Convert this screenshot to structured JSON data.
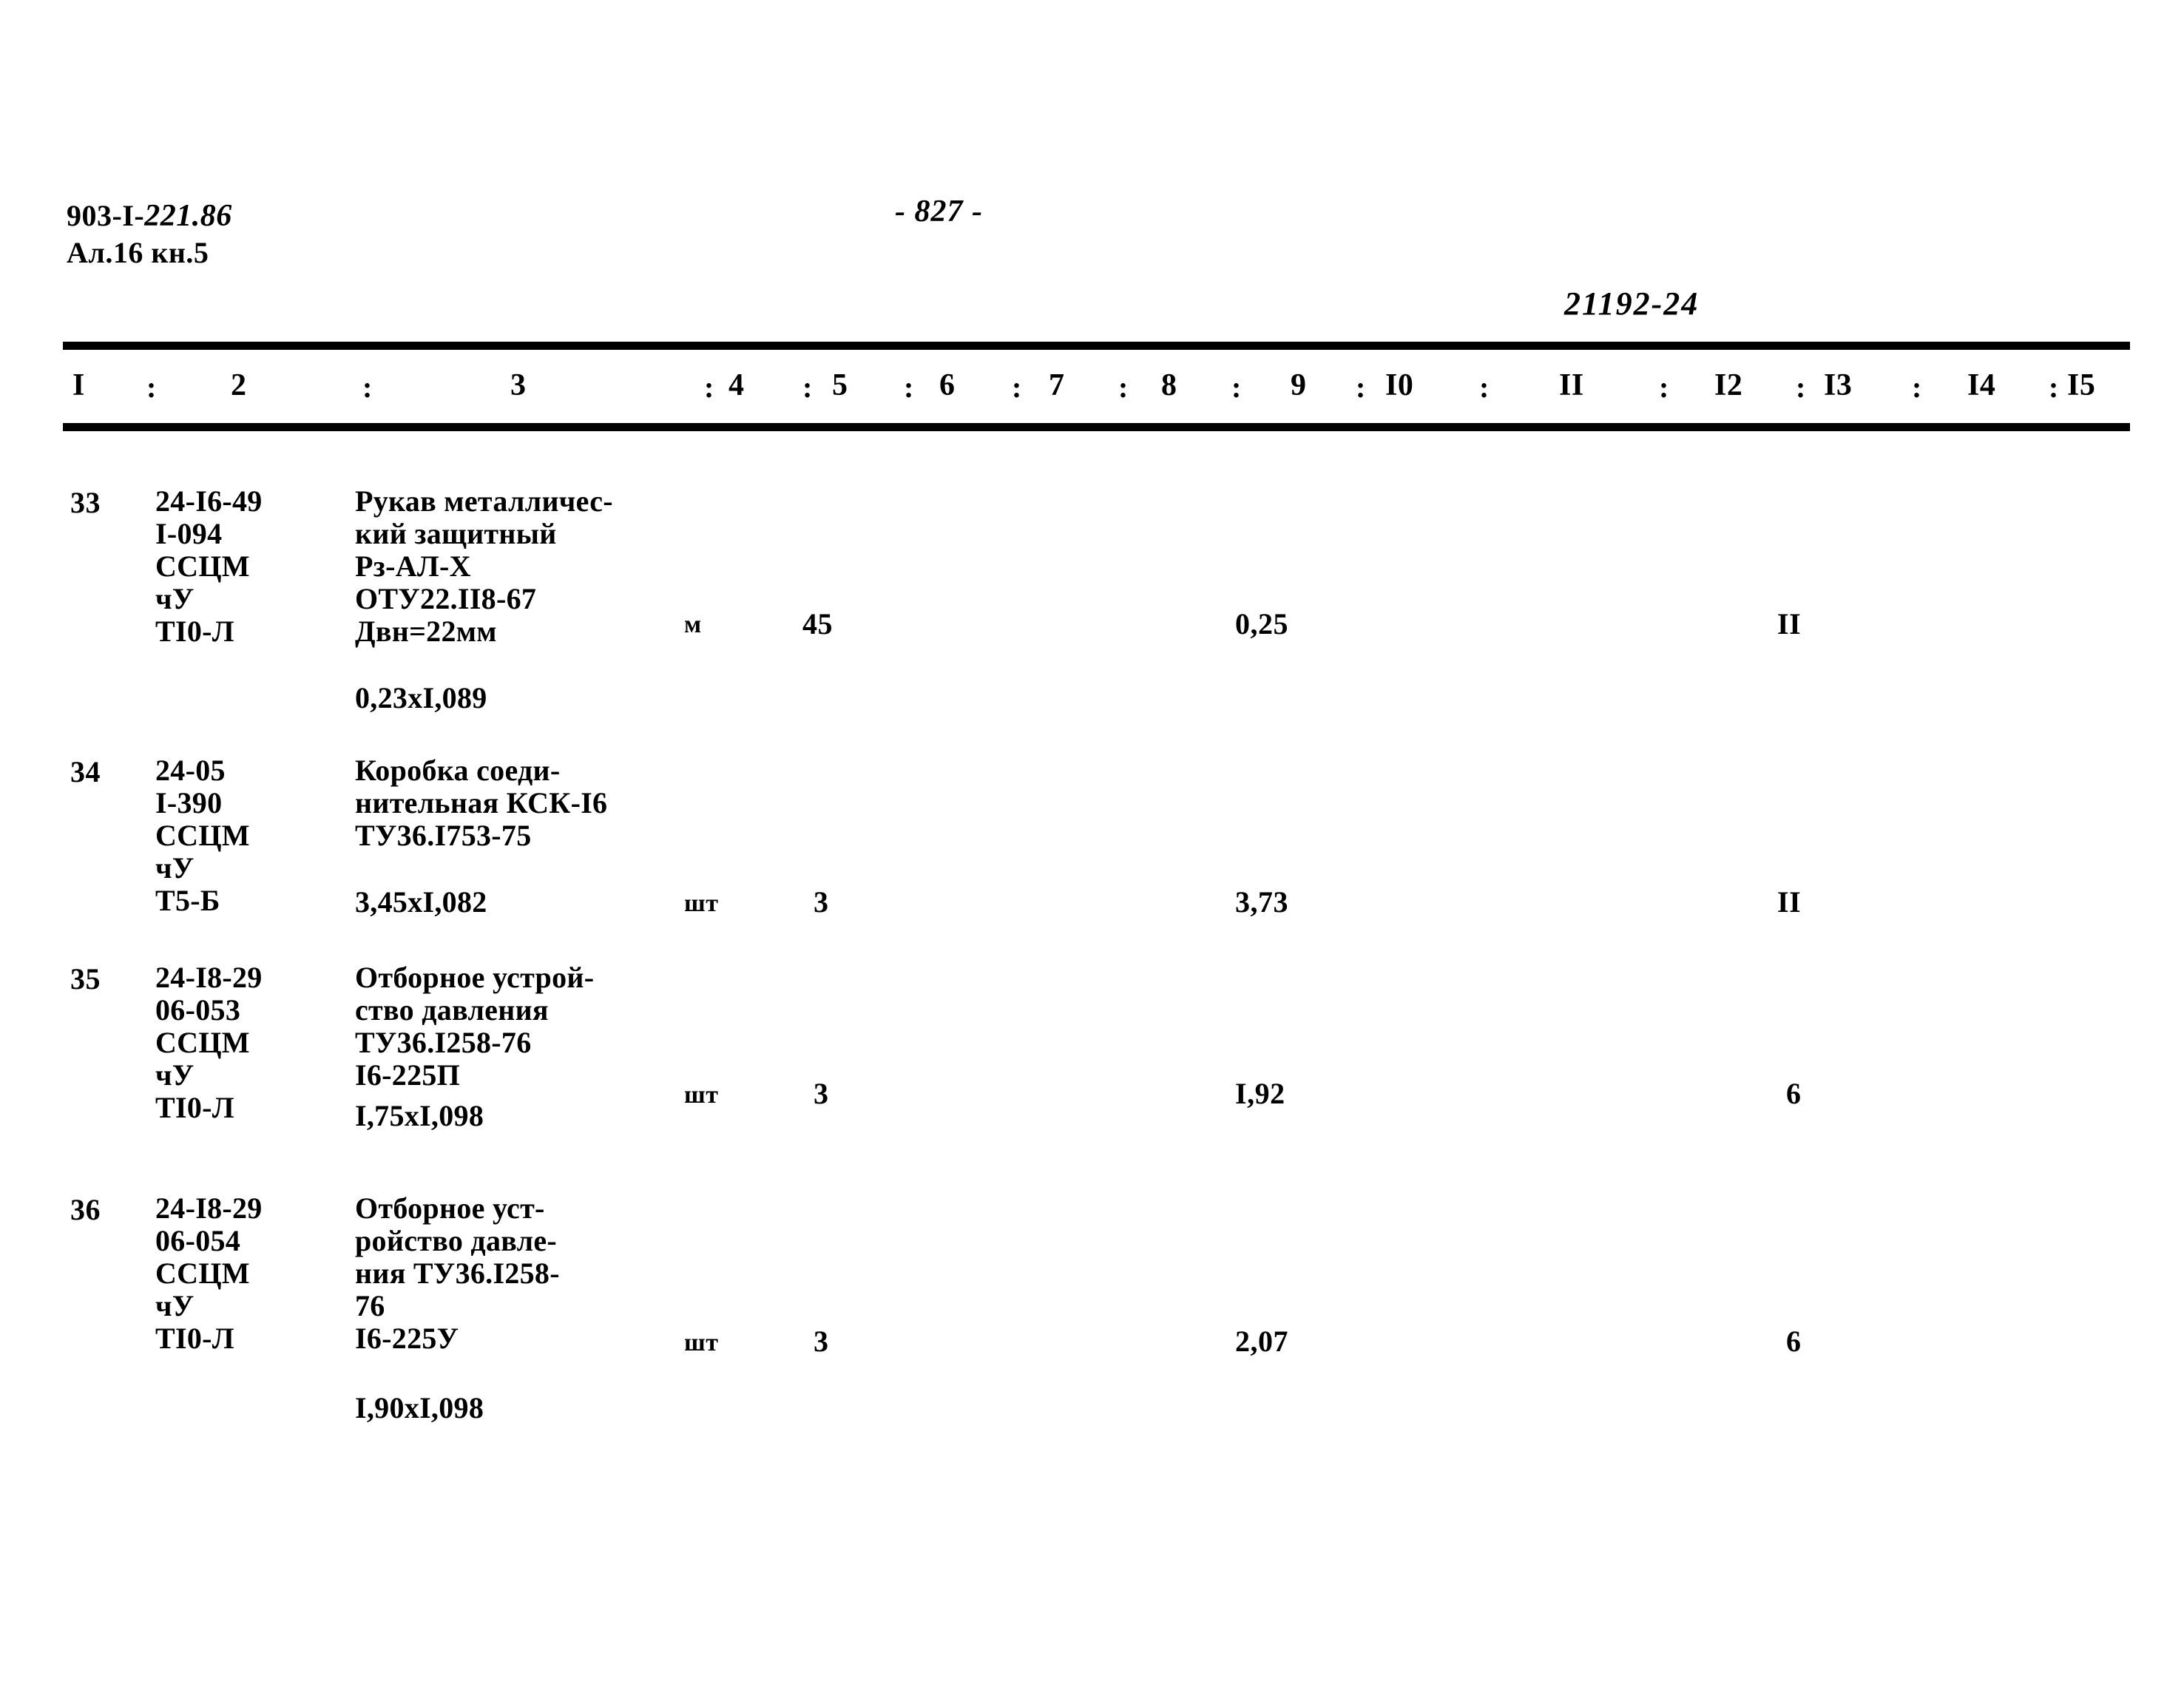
{
  "header": {
    "doc_code_printed": "903-I-",
    "doc_code_hand": "221.86",
    "doc_sub": "Ал.16 кн.5",
    "page_number": "- 827 -",
    "stamp": "21192-24"
  },
  "table": {
    "column_headers": [
      "I",
      "2",
      "3",
      "4",
      "5",
      "6",
      "7",
      "8",
      "9",
      "I0",
      "II",
      "I2",
      "I3",
      "I4",
      "I5"
    ],
    "separator": ":",
    "rows": [
      {
        "num": "33",
        "code_lines": [
          "24-I6-49",
          "I-094",
          "ССЦМ",
          "чУ",
          "ТI0-Л"
        ],
        "name_lines": [
          "Рукав металличес-",
          "кий защитный",
          "Рз-АЛ-Х",
          "ОТУ22.II8-67",
          "Двн=22мм"
        ],
        "coefficient": "0,23хI,089",
        "unit": "м",
        "qty": "45",
        "price": "0,25",
        "col12": "II"
      },
      {
        "num": "34",
        "code_lines": [
          "24-05",
          "I-390",
          "ССЦМ",
          "чУ",
          "Т5-Б"
        ],
        "name_lines": [
          "Коробка соеди-",
          "нительная КСК-I6",
          "ТУ36.I753-75"
        ],
        "coefficient": "3,45хI,082",
        "unit": "шт",
        "qty": "3",
        "price": "3,73",
        "col12": "II"
      },
      {
        "num": "35",
        "code_lines": [
          "24-I8-29",
          "06-053",
          "ССЦМ",
          "чУ",
          "ТI0-Л"
        ],
        "name_lines": [
          "Отборное устрой-",
          "ство давления",
          "ТУ36.I258-76",
          "I6-225П"
        ],
        "coefficient": "I,75хI,098",
        "unit": "шт",
        "qty": "3",
        "price": "I,92",
        "col12": "6"
      },
      {
        "num": "36",
        "code_lines": [
          "24-I8-29",
          "06-054",
          "ССЦМ",
          "чУ",
          "ТI0-Л"
        ],
        "name_lines": [
          "Отборное уст-",
          "ройство давле-",
          "ния ТУ36.I258-",
          "76",
          "I6-225У"
        ],
        "coefficient": "I,90хI,098",
        "unit": "шт",
        "qty": "3",
        "price": "2,07",
        "col12": "6"
      }
    ]
  }
}
